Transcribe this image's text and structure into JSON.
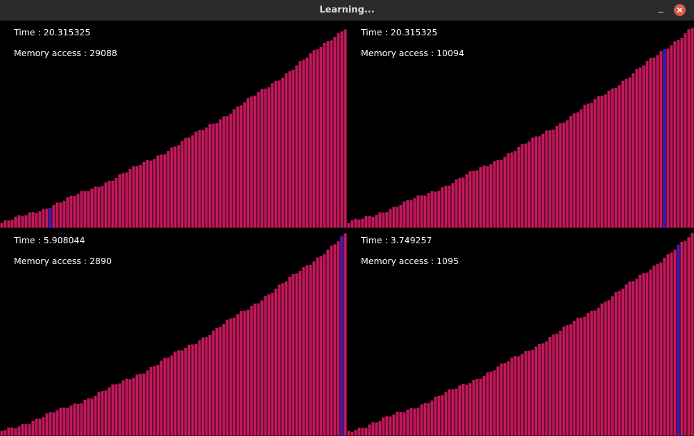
{
  "window": {
    "title": "Learning..."
  },
  "colors": {
    "bar": "#c2185b",
    "highlight": "#2020e0",
    "background": "#000000"
  },
  "panels": [
    {
      "time": "Time : 20.315325",
      "memory": "Memory access : 29088",
      "highlight_index": 14
    },
    {
      "time": "Time : 20.315325",
      "memory": "Memory access : 10094",
      "highlight_index": 91
    },
    {
      "time": "Time : 5.908044",
      "memory": "Memory access : 2890",
      "highlight_index": 98
    },
    {
      "time": "Time : 3.749257",
      "memory": "Memory access : 1095",
      "highlight_index": 95
    }
  ],
  "bar_count": 100
}
